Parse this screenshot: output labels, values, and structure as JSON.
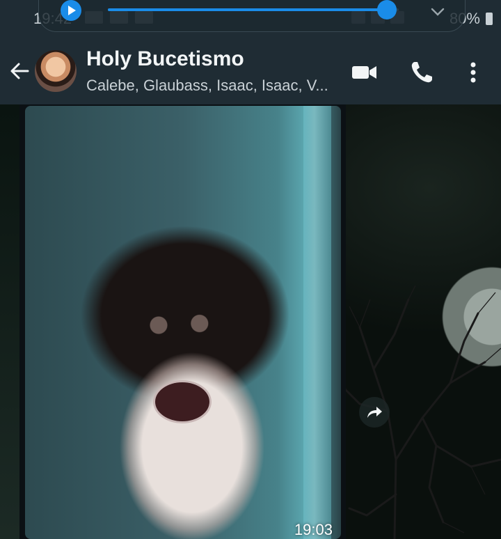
{
  "status_bar": {
    "time": "19:42",
    "battery": "80%"
  },
  "media_player": {
    "progress": 0.96
  },
  "header": {
    "title": "Holy Bucetismo",
    "subtitle": "Calebe, Glaubass, Isaac, Isaac, V..."
  },
  "media": {
    "timestamp": "19:03"
  },
  "icons": {
    "play": "play-icon",
    "collapse": "chevron-down-icon",
    "back": "arrow-left-icon",
    "video_call": "video-camera-icon",
    "voice_call": "phone-icon",
    "menu": "more-vertical-icon",
    "forward": "forward-arrow-icon"
  },
  "colors": {
    "header_bg": "#1f2c34",
    "accent": "#1a8ce8"
  }
}
